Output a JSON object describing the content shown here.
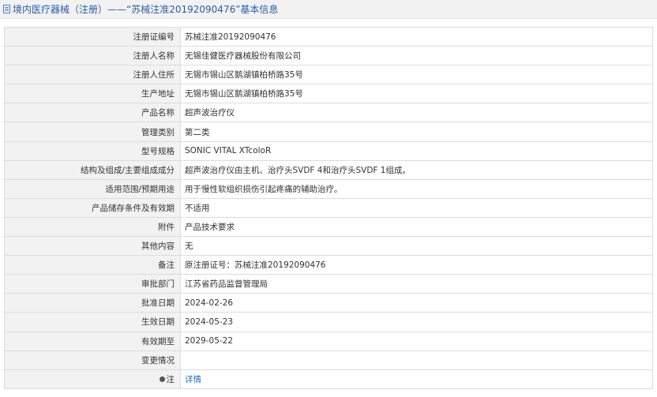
{
  "header": {
    "title": "境内医疗器械（注册）——“苏械注准20192090476”基本信息"
  },
  "rows": [
    {
      "label": "注册证编号",
      "value": "苏械注准20192090476"
    },
    {
      "label": "注册人名称",
      "value": "无锡佳健医疗器械股份有限公司"
    },
    {
      "label": "注册人住所",
      "value": "无锡市锡山区鹅湖镇柏桥路35号"
    },
    {
      "label": "生产地址",
      "value": "无锡市锡山区鹅湖镇柏桥路35号"
    },
    {
      "label": "产品名称",
      "value": "超声波治疗仪"
    },
    {
      "label": "管理类别",
      "value": "第二类"
    },
    {
      "label": "型号规格",
      "value": "SONIC VITAL XTcoloR"
    },
    {
      "label": "结构及组成/主要组成成分",
      "value": "超声波治疗仪由主机、治疗头SVDF 4和治疗头SVDF 1组成。"
    },
    {
      "label": "适用范围/预期用途",
      "value": "用于慢性软组织损伤引起疼痛的辅助治疗。"
    },
    {
      "label": "产品储存条件及有效期",
      "value": "不适用"
    },
    {
      "label": "附件",
      "value": "产品技术要求"
    },
    {
      "label": "其他内容",
      "value": "无"
    },
    {
      "label": "备注",
      "value": "原注册证号：苏械注准20192090476"
    },
    {
      "label": "审批部门",
      "value": "江苏省药品监督管理局"
    },
    {
      "label": "批准日期",
      "value": "2024-02-26"
    },
    {
      "label": "生效日期",
      "value": "2024-05-23"
    },
    {
      "label": "有效期至",
      "value": "2029-05-22"
    },
    {
      "label": "变更情况",
      "value": ""
    }
  ],
  "note_row": {
    "label": "注",
    "link_text": "详情",
    "icon": "pin-icon"
  }
}
